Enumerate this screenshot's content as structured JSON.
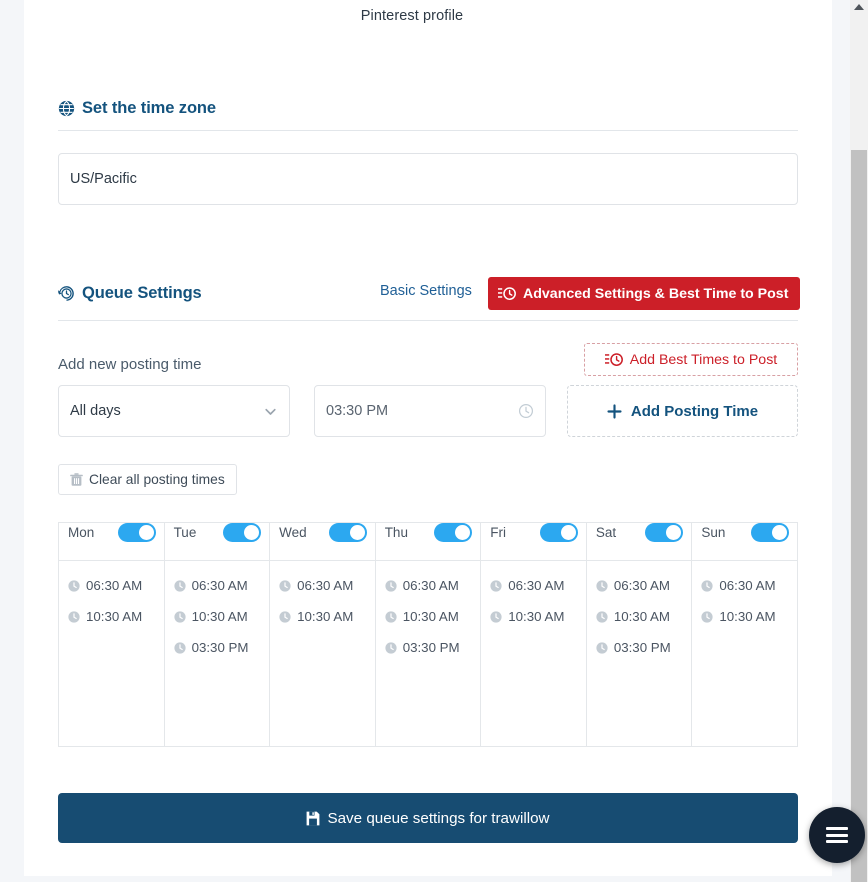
{
  "page": {
    "profile_caption": "Pinterest profile"
  },
  "timezone_section": {
    "icon": "globe-icon",
    "title": "Set the time zone",
    "value": "US/Pacific"
  },
  "queue_section": {
    "icon": "history-clock-icon",
    "title": "Queue Settings",
    "tabs": [
      {
        "label": "Basic Settings",
        "active": false
      },
      {
        "label": "Advanced Settings & Best Time to Post",
        "active": true,
        "icon": "list-clock-icon"
      }
    ],
    "add_label": "Add new posting time",
    "best_times_button": {
      "label": "Add Best Times to Post",
      "icon": "list-clock-icon"
    },
    "day_select": {
      "value": "All days",
      "icon": "chevron-down-icon"
    },
    "time_input": {
      "value": "03:30 PM",
      "placeholder": "03:30 PM",
      "icon": "clock-outline-icon"
    },
    "add_posting_time_button": {
      "label": "Add Posting Time",
      "icon": "plus-icon"
    },
    "clear_button": {
      "label": "Clear all posting times",
      "icon": "trash-icon"
    }
  },
  "schedule": {
    "slot_icon": "clock-icon",
    "days": [
      {
        "name": "Mon",
        "enabled": true,
        "times": [
          "06:30 AM",
          "10:30 AM"
        ]
      },
      {
        "name": "Tue",
        "enabled": true,
        "times": [
          "06:30 AM",
          "10:30 AM",
          "03:30 PM"
        ]
      },
      {
        "name": "Wed",
        "enabled": true,
        "times": [
          "06:30 AM",
          "10:30 AM"
        ]
      },
      {
        "name": "Thu",
        "enabled": true,
        "times": [
          "06:30 AM",
          "10:30 AM",
          "03:30 PM"
        ]
      },
      {
        "name": "Fri",
        "enabled": true,
        "times": [
          "06:30 AM",
          "10:30 AM"
        ]
      },
      {
        "name": "Sat",
        "enabled": true,
        "times": [
          "06:30 AM",
          "10:30 AM",
          "03:30 PM"
        ]
      },
      {
        "name": "Sun",
        "enabled": true,
        "times": [
          "06:30 AM",
          "10:30 AM"
        ]
      }
    ]
  },
  "save_button": {
    "label": "Save queue settings for trawillow",
    "icon": "save-icon"
  },
  "fab": {
    "icon": "hamburger-menu-icon"
  },
  "colors": {
    "brand_blue": "#14537e",
    "accent_red": "#cc1f28",
    "toggle_on": "#2ca8f0",
    "save_bg": "#174c72",
    "fab_bg": "#141f2e"
  }
}
